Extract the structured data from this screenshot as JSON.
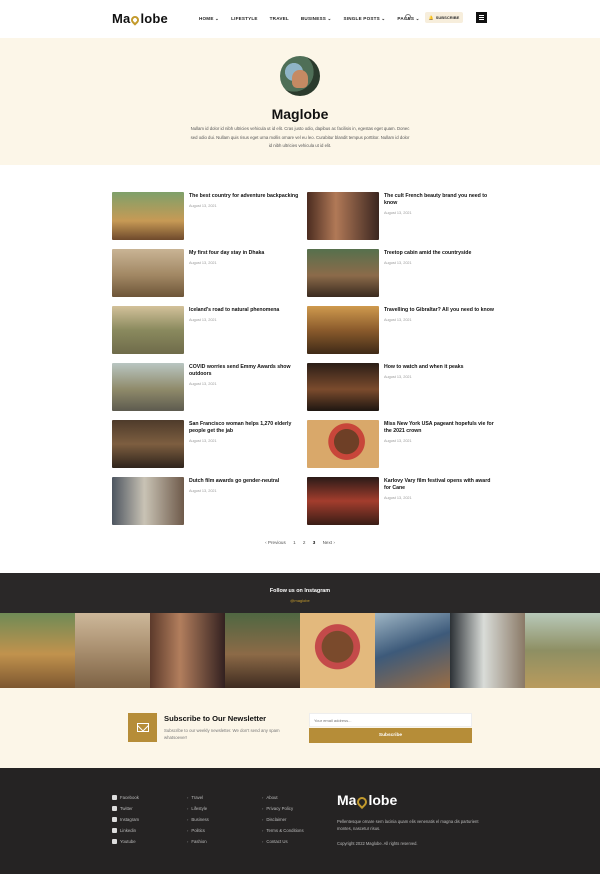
{
  "header": {
    "logo_prefix": "Ma",
    "logo_suffix": "lobe",
    "nav": [
      "HOME ⌄",
      "LIFESTYLE",
      "TRAVEL",
      "BUSINESS ⌄",
      "SINGLE POSTS ⌄",
      "PAGES ⌄"
    ],
    "subscribe_label": "SUBSCRIBE"
  },
  "author": {
    "name": "Maglobe",
    "bio": "Nullam id dolor id nibh ultricies vehicula ut id elit. Cras justo odio, dapibus ac facilisis in, egestas eget quam. Donec sed odio dui. Nullam quis risus eget urna mollis ornare vel eu leo. Curabitur blandit tempus porttitor. Nullam id dolor id nibh ultricies vehicula ut id elit."
  },
  "posts_left": [
    {
      "title": "The best country for adventure backpacking",
      "date": "August 13, 2021"
    },
    {
      "title": "My first four day stay in Dhaka",
      "date": "August 13, 2021"
    },
    {
      "title": "Iceland's road to natural phenomena",
      "date": "August 13, 2021"
    },
    {
      "title": "COVID worries send Emmy Awards show outdoors",
      "date": "August 13, 2021"
    },
    {
      "title": "San Francisco woman helps 1,270 elderly people get the jab",
      "date": "August 13, 2021"
    },
    {
      "title": "Dutch film awards go gender-neutral",
      "date": "August 13, 2021"
    }
  ],
  "posts_right": [
    {
      "title": "The cult French beauty brand you need to know",
      "date": "August 13, 2021"
    },
    {
      "title": "Treetop cabin amid the countryside",
      "date": "August 13, 2021"
    },
    {
      "title": "Travelling to Gibraltar? All you need to know",
      "date": "August 13, 2021"
    },
    {
      "title": "How to watch and when it peaks",
      "date": "August 13, 2021"
    },
    {
      "title": "Miss New York USA pageant hopefuls vie for the 2021 crown",
      "date": "August 13, 2021"
    },
    {
      "title": "Karlovy Vary film festival opens with award for Cane",
      "date": "August 13, 2021"
    }
  ],
  "pagination": {
    "prev": "‹ Previous",
    "pages": [
      "1",
      "2",
      "3"
    ],
    "next": "Next ›"
  },
  "instagram": {
    "title": "Follow us on Instagram",
    "handle": "@maglobe"
  },
  "newsletter": {
    "title": "Subscribe to Our Newsletter",
    "desc": "Subscribe to our weekly newsletter. We don't send any spam whatsoever!",
    "placeholder": "Your email address...",
    "button": "Subscribe"
  },
  "footer": {
    "social": [
      "Facebook",
      "Twitter",
      "Instagram",
      "Linkedin",
      "Youtube"
    ],
    "cats": [
      "Travel",
      "Lifestyle",
      "Business",
      "Politics",
      "Fashion"
    ],
    "pages": [
      "About",
      "Privacy Policy",
      "Disclaimer",
      "Terms & Conditions",
      "Contact Us"
    ],
    "logo_prefix": "Ma",
    "logo_suffix": "lobe",
    "desc": "Pellentesque ornare sem lacinia quam elis venenatis el magna dis parturient montes, nascetur risus.",
    "copyright": "Copyright 2022 Maglobe. All rights reserved."
  }
}
